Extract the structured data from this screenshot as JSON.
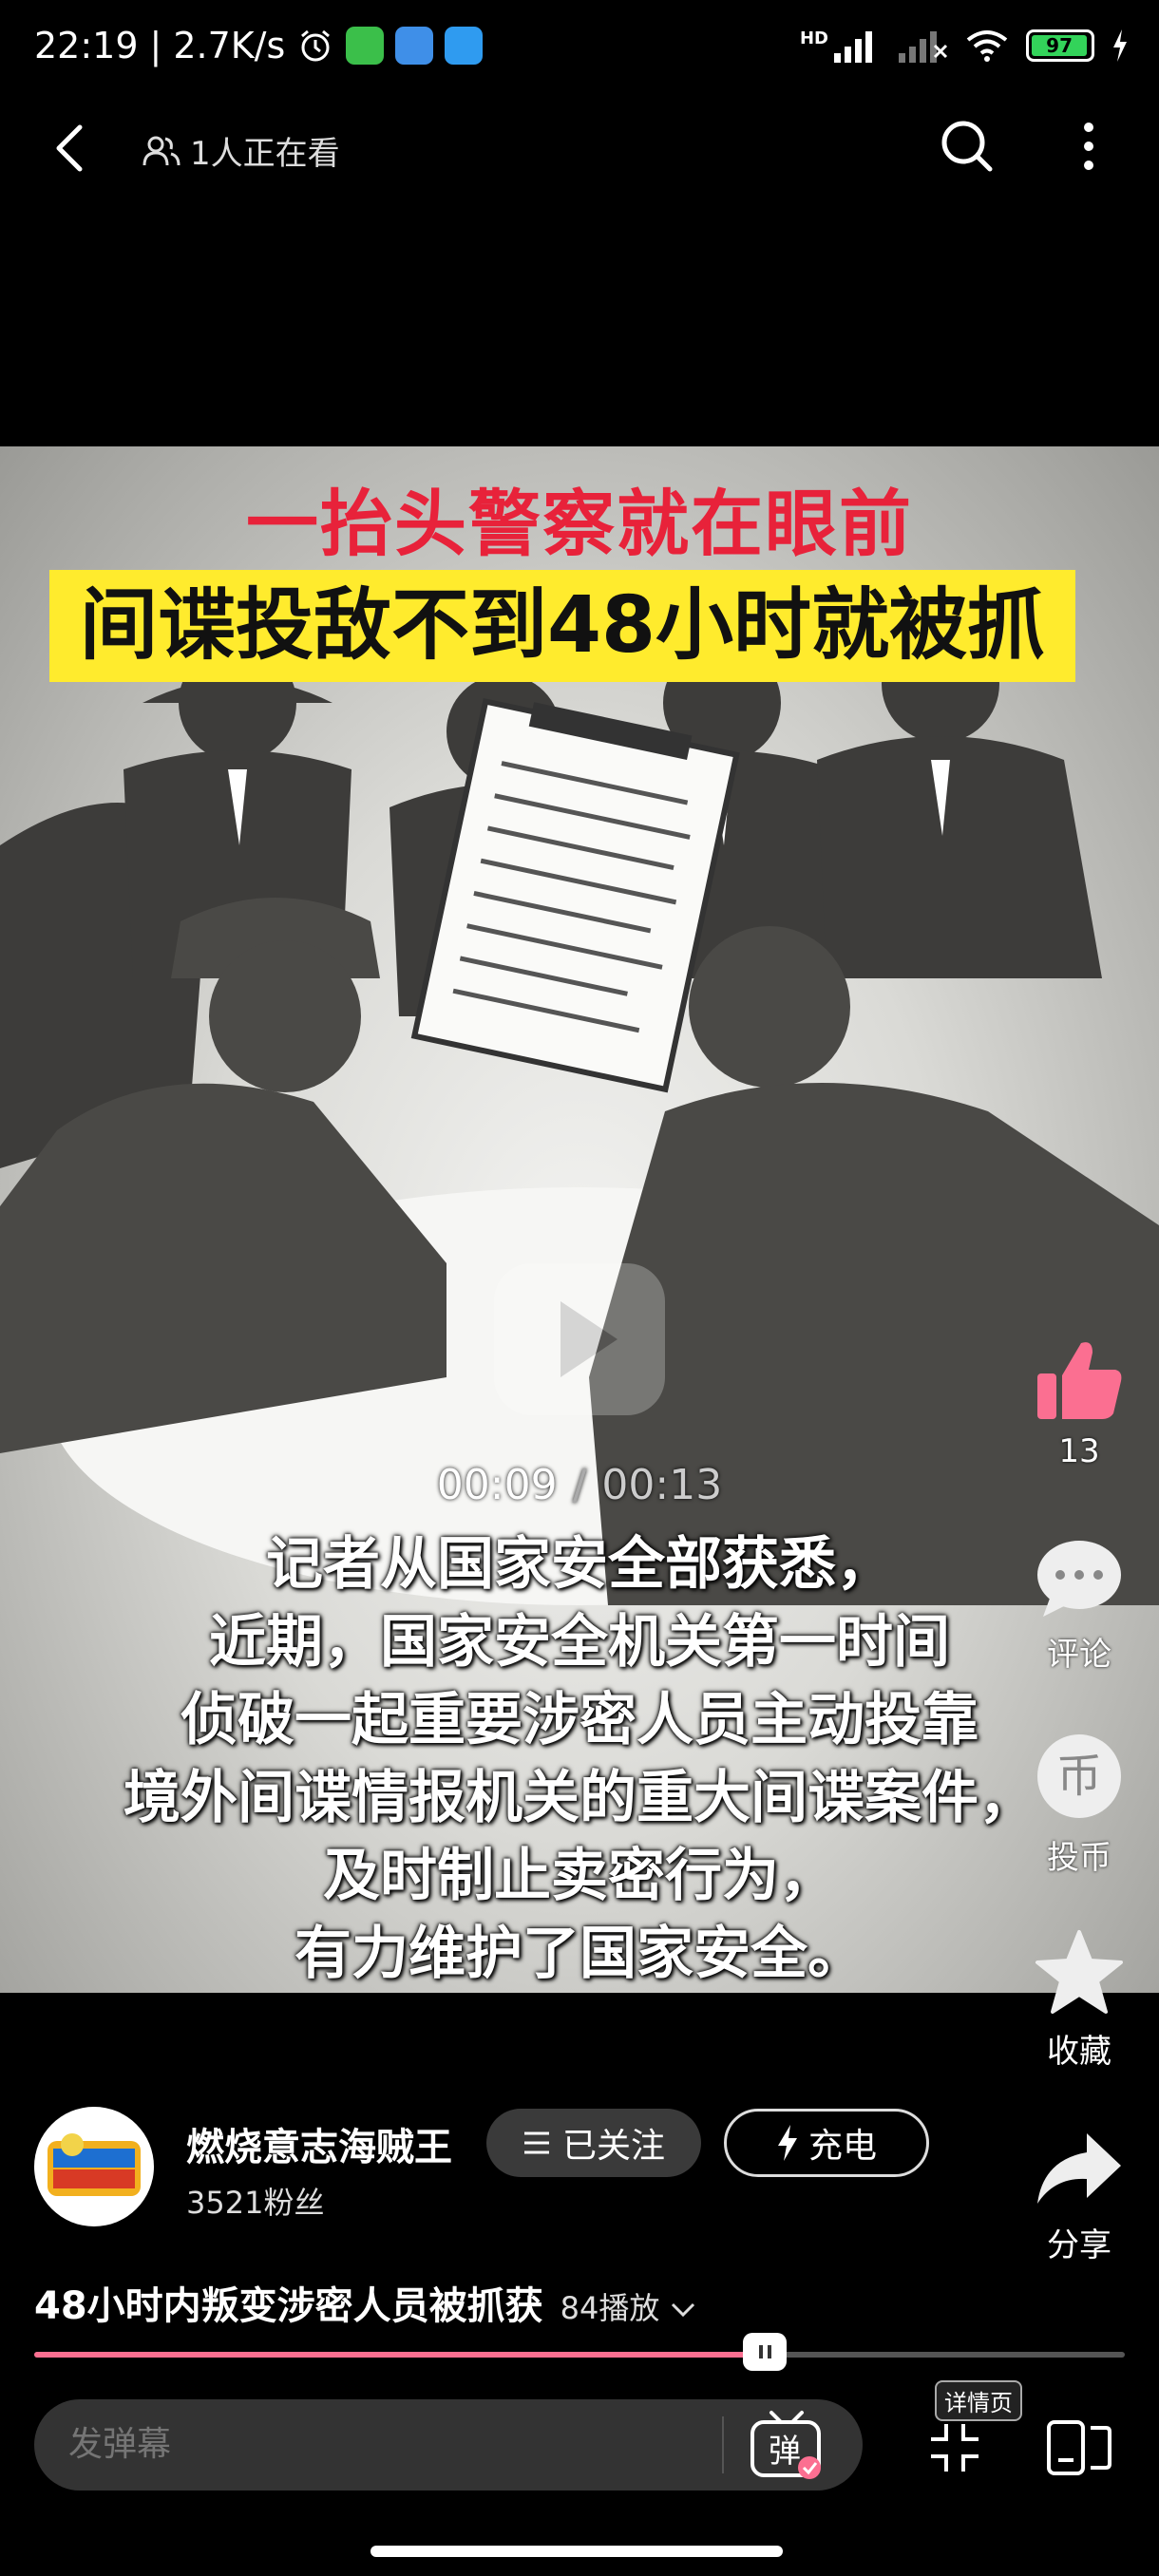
{
  "status_bar": {
    "time": "22:19",
    "separator": "|",
    "net_speed": "2.7K/s",
    "signal_label": "HD",
    "battery": "97",
    "battery_percent": 97,
    "icons": [
      "alarm-icon",
      "power-saver-app-icon",
      "weather-app-icon",
      "upload-app-icon",
      "signal-icon",
      "wifi-icon",
      "battery-icon",
      "charging-icon"
    ]
  },
  "top_nav": {
    "watching_text": "1人正在看",
    "icons": [
      "back-icon",
      "people-icon",
      "search-icon",
      "more-icon"
    ]
  },
  "video": {
    "headline_1": "一抬头警察就在眼前",
    "headline_2": "间谍投敌不到48小时就被抓",
    "subtitles": [
      "记者从国家安全部获悉，",
      "近期，国家安全机关第一时间",
      "侦破一起重要涉密人员主动投靠",
      "境外间谍情报机关的重大间谍案件，",
      "及时制止卖密行为，",
      "有力维护了国家安全。"
    ],
    "current_time": "00:09",
    "time_separator": "/",
    "total_time": "00:13",
    "progress": 0.67,
    "colors": {
      "headline_red": "#e8223a",
      "headline_bg": "#ffeb2d",
      "progress": "#fb6f91"
    }
  },
  "actions": {
    "like_count": "13",
    "comment_label": "评论",
    "coin_label": "投币",
    "coin_glyph": "币",
    "favorite_label": "收藏",
    "share_label": "分享"
  },
  "uploader": {
    "name": "燃烧意志海贼王",
    "fans": "3521粉丝",
    "follow_label": "已关注",
    "charge_label": "充电"
  },
  "video_info": {
    "title": "48小时内叛变涉密人员被抓获",
    "views": "84播放"
  },
  "bottom_bar": {
    "danmaku_placeholder": "发弹幕",
    "danmaku_toggle_label": "弹",
    "detail_label": "详情页"
  }
}
